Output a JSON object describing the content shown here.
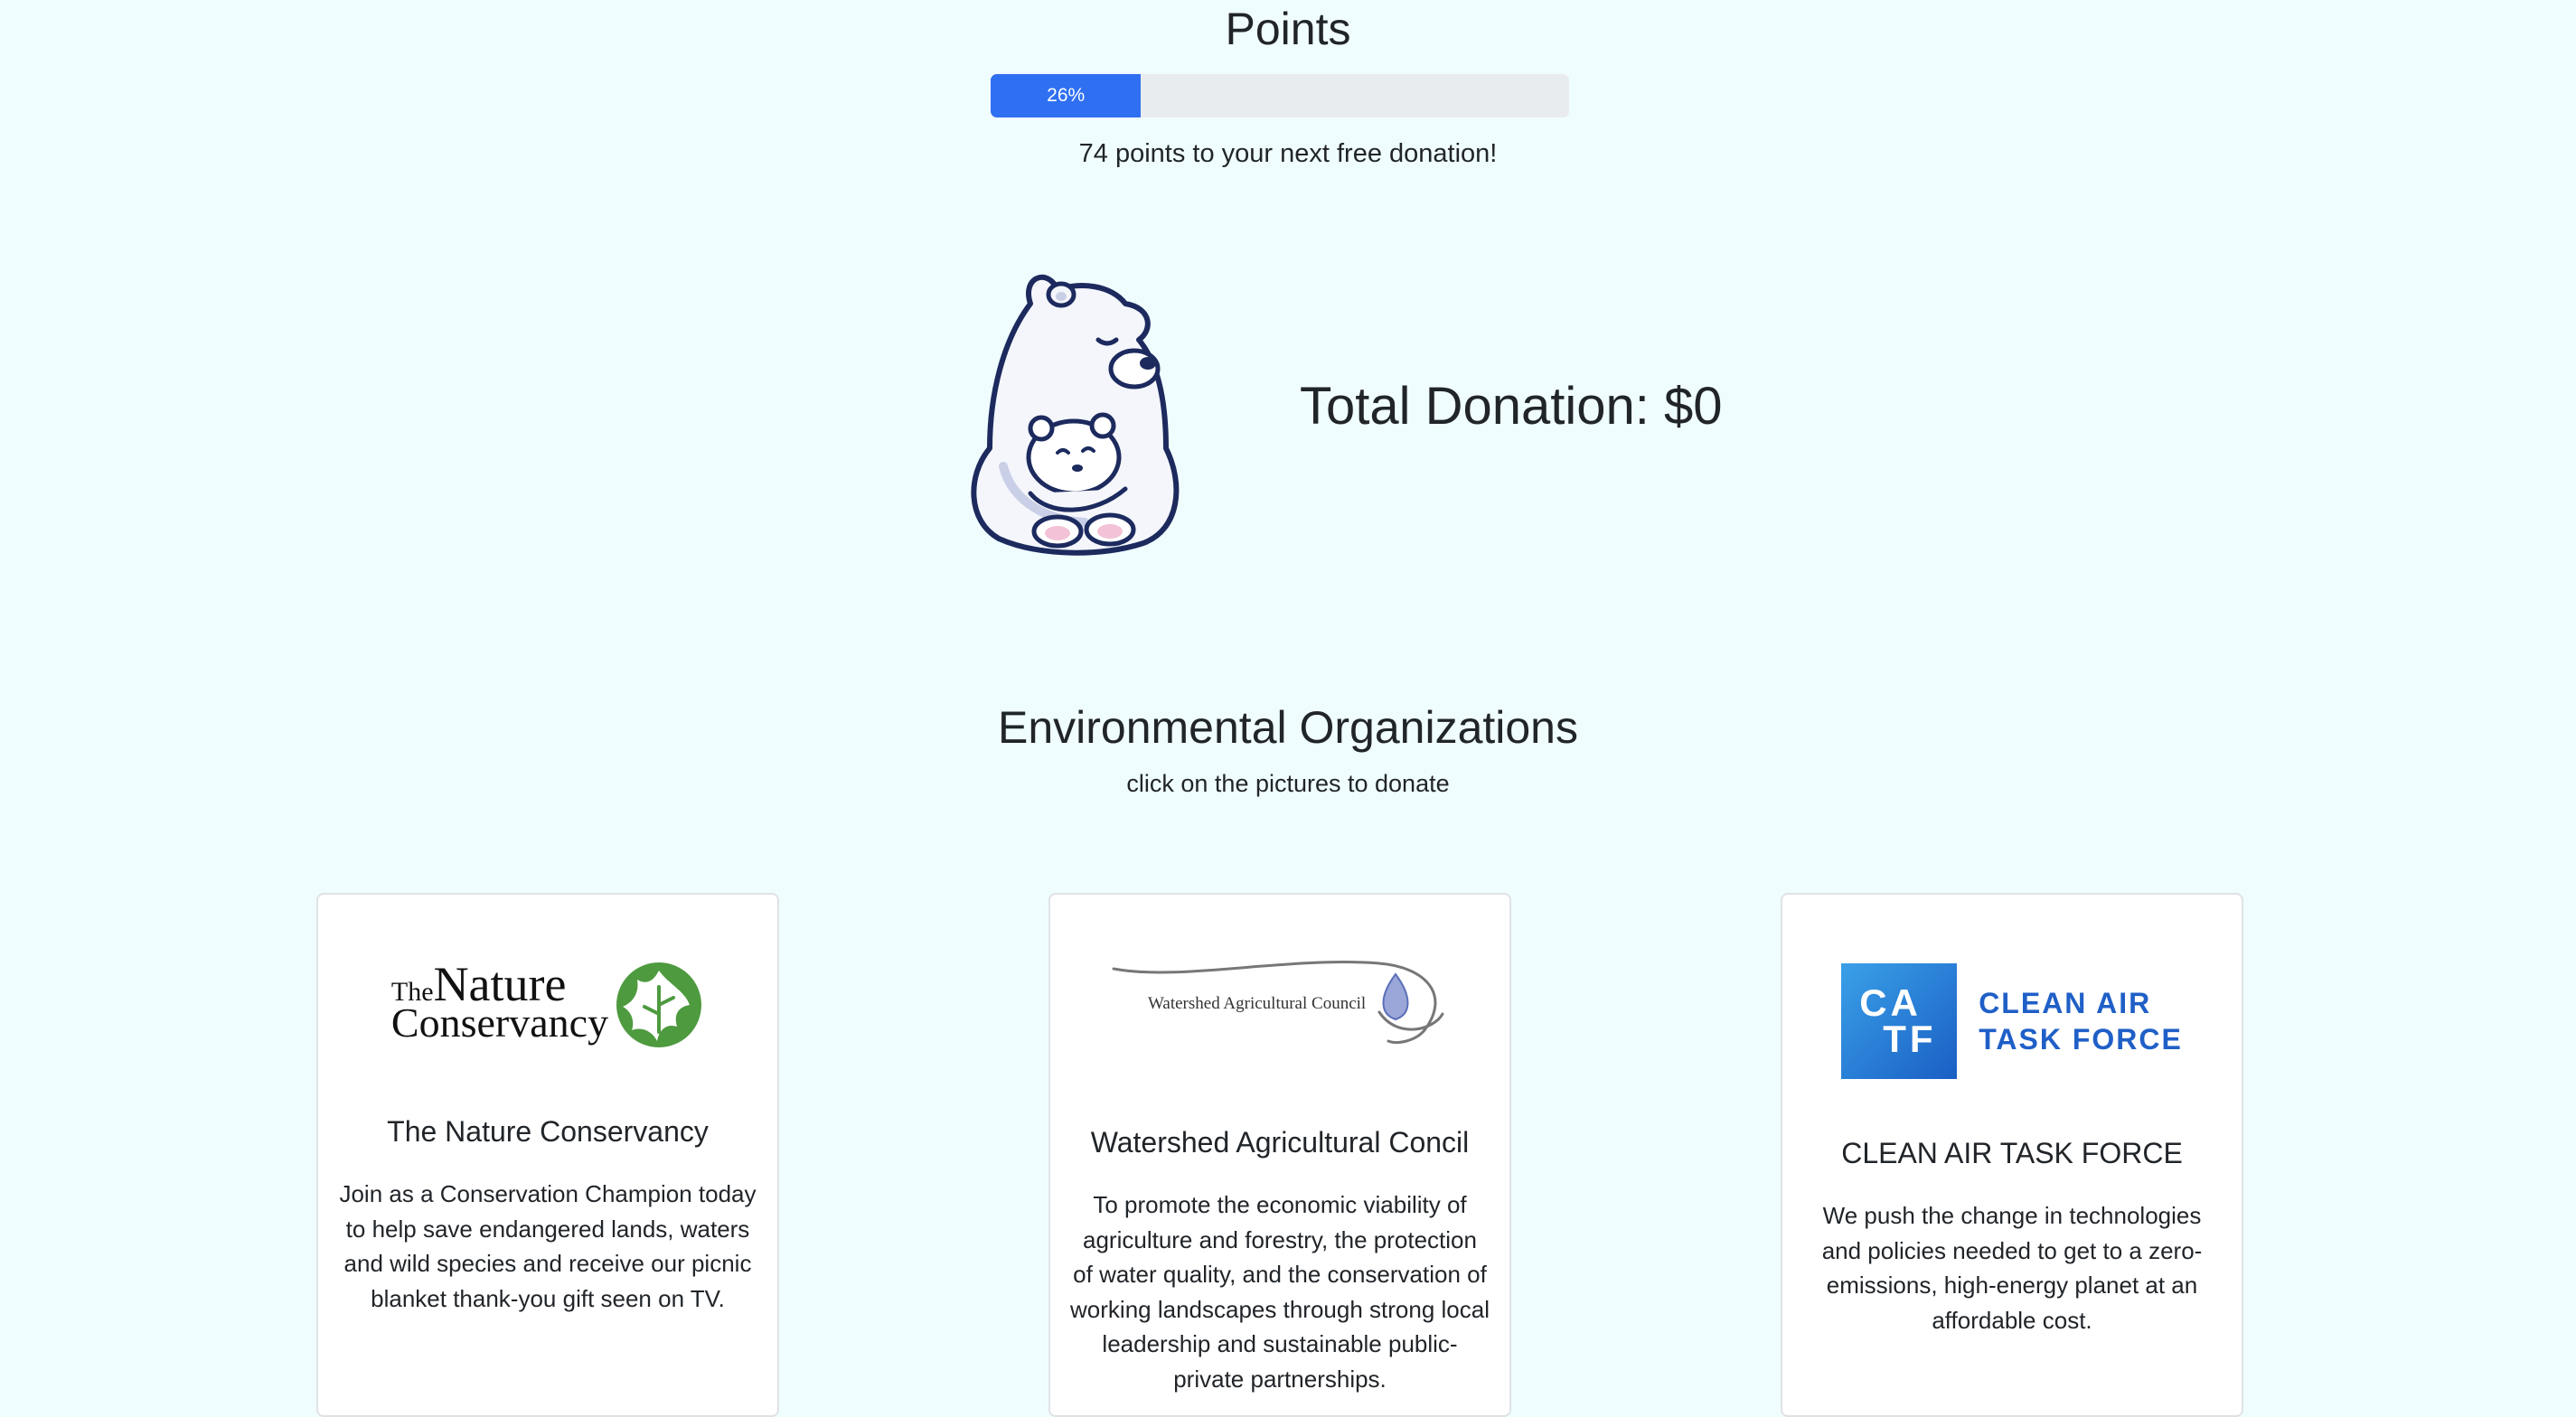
{
  "points": {
    "title": "Points",
    "progress_label": "26%",
    "progress_fraction": 0.26,
    "remaining_text": "74 points to your next free donation!"
  },
  "donation": {
    "total_text": "Total Donation: $0",
    "mascot_icon": "polar-bear-mother-and-cub-icon"
  },
  "organizations": {
    "title": "Environmental Organizations",
    "subtitle": "click on the pictures to donate",
    "cards": [
      {
        "logo_text_line1_small": "The",
        "logo_text_line1_big": "Nature",
        "logo_text_line2": "Conservancy",
        "logo_icon": "green-leaf-globe-icon",
        "title": "The Nature Conservancy",
        "text": "Join as a Conservation Champion today to help save endangered lands, waters and wild species and receive our picnic blanket thank-you gift seen on TV."
      },
      {
        "logo_text": "Watershed Agricultural Council",
        "logo_icon": "water-drop-swoosh-icon",
        "title": "Watershed Agricultural Concil",
        "text": "To promote the economic viability of agriculture and forestry, the protection of water quality, and the conservation of working landscapes through strong local leadership and sustainable public-private partnerships."
      },
      {
        "logo_box_row1": "CA",
        "logo_box_row2": "TF",
        "logo_name_line1": "CLEAN AIR",
        "logo_name_line2": "TASK FORCE",
        "title": "CLEAN AIR TASK FORCE",
        "text": "We push the change in technologies and policies needed to get to a zero-emissions, high-energy planet at an affordable cost."
      }
    ]
  },
  "colors": {
    "background": "#f0fdff",
    "progress_fill": "#2f6ff2",
    "progress_track": "#e9ecef",
    "tnc_green": "#4e9a3f",
    "catf_blue": "#1f5fc7"
  }
}
